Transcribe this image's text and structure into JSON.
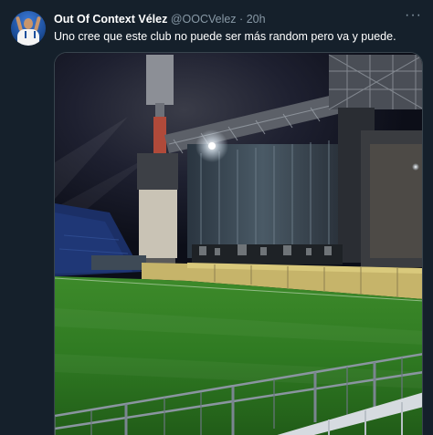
{
  "tweet": {
    "author_name": "Out Of Context Vélez",
    "handle": "@OOCVelez",
    "separator": "·",
    "time": "20h",
    "more": "···",
    "text": "Uno cree que este club no puede ser más random pero va y puede."
  }
}
